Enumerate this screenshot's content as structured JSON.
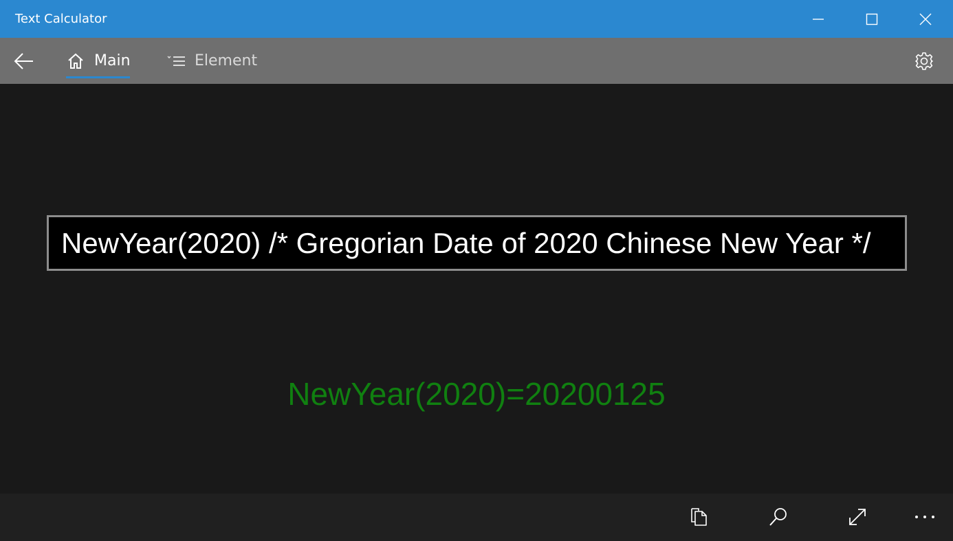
{
  "window": {
    "title": "Text Calculator",
    "accent_color": "#2b88d0",
    "controls": [
      "minimize-icon",
      "maximize-icon",
      "close-icon"
    ]
  },
  "nav": {
    "back_icon": "back-arrow-icon",
    "tabs": [
      {
        "label": "Main",
        "icon": "home-icon",
        "selected": true
      },
      {
        "label": "Element",
        "icon": "list-icon",
        "selected": false
      }
    ],
    "settings_icon": "gear-icon"
  },
  "main": {
    "expression": "NewYear(2020) /* Gregorian Date of 2020 Chinese New Year */",
    "result": "NewYear(2020)=20200125",
    "result_color": "#108010"
  },
  "bottom": {
    "commands": [
      "copy-icon",
      "search-icon",
      "expand-icon",
      "more-icon"
    ]
  }
}
